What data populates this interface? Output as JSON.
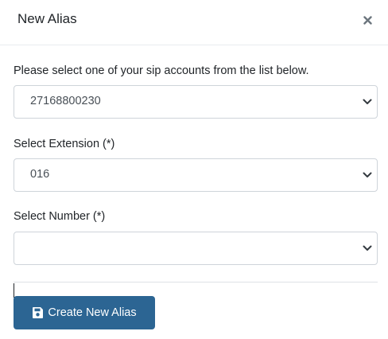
{
  "modal": {
    "title": "New Alias",
    "close_icon": "close-icon"
  },
  "form": {
    "sip_account": {
      "label": "Please select one of your sip accounts from the list below.",
      "value": "27168800230"
    },
    "extension": {
      "label": "Select Extension (*)",
      "value": "016"
    },
    "number": {
      "label": "Select Number (*)",
      "value": ""
    }
  },
  "actions": {
    "create_label": "Create New Alias",
    "create_icon": "save-icon"
  },
  "colors": {
    "primary": "#2c6593",
    "border": "#ced4da",
    "text": "#212529",
    "muted_text": "#495057"
  }
}
